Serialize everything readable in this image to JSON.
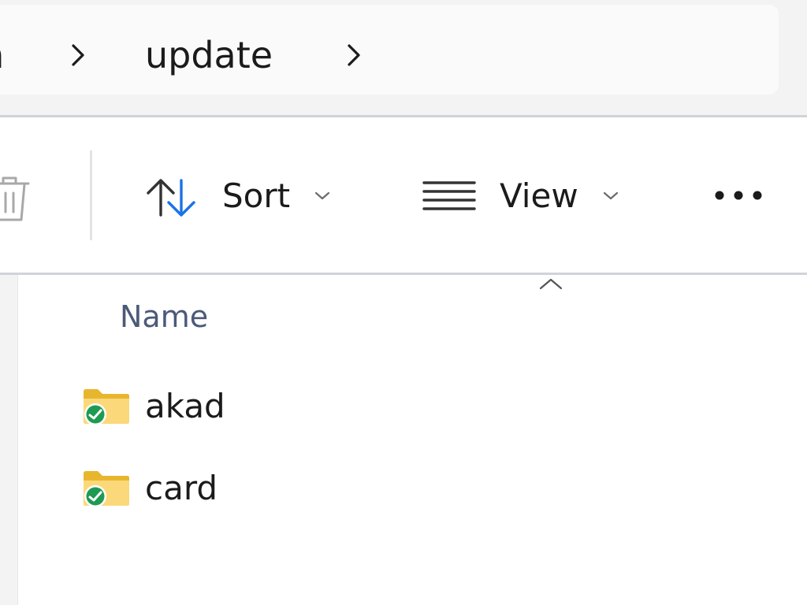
{
  "breadcrumb": {
    "items": [
      "on",
      "update"
    ]
  },
  "toolbar": {
    "sort_label": "Sort",
    "view_label": "View"
  },
  "list": {
    "column_name": "Name",
    "sort_direction": "ascending",
    "items": [
      {
        "name": "akad",
        "type": "folder",
        "status": "synced"
      },
      {
        "name": "card",
        "type": "folder",
        "status": "synced"
      }
    ]
  },
  "icons": {
    "breadcrumb_separator": "chevron-right-icon",
    "delete": "trash-icon",
    "sort": "sort-arrows-icon",
    "view": "view-lines-icon",
    "more": "more-icon",
    "folder": "folder-icon",
    "sync_status": "sync-status-icon"
  },
  "colors": {
    "accent": "#1a73e8",
    "folder": "#f4c542",
    "sync_status": "#1e9a52"
  }
}
